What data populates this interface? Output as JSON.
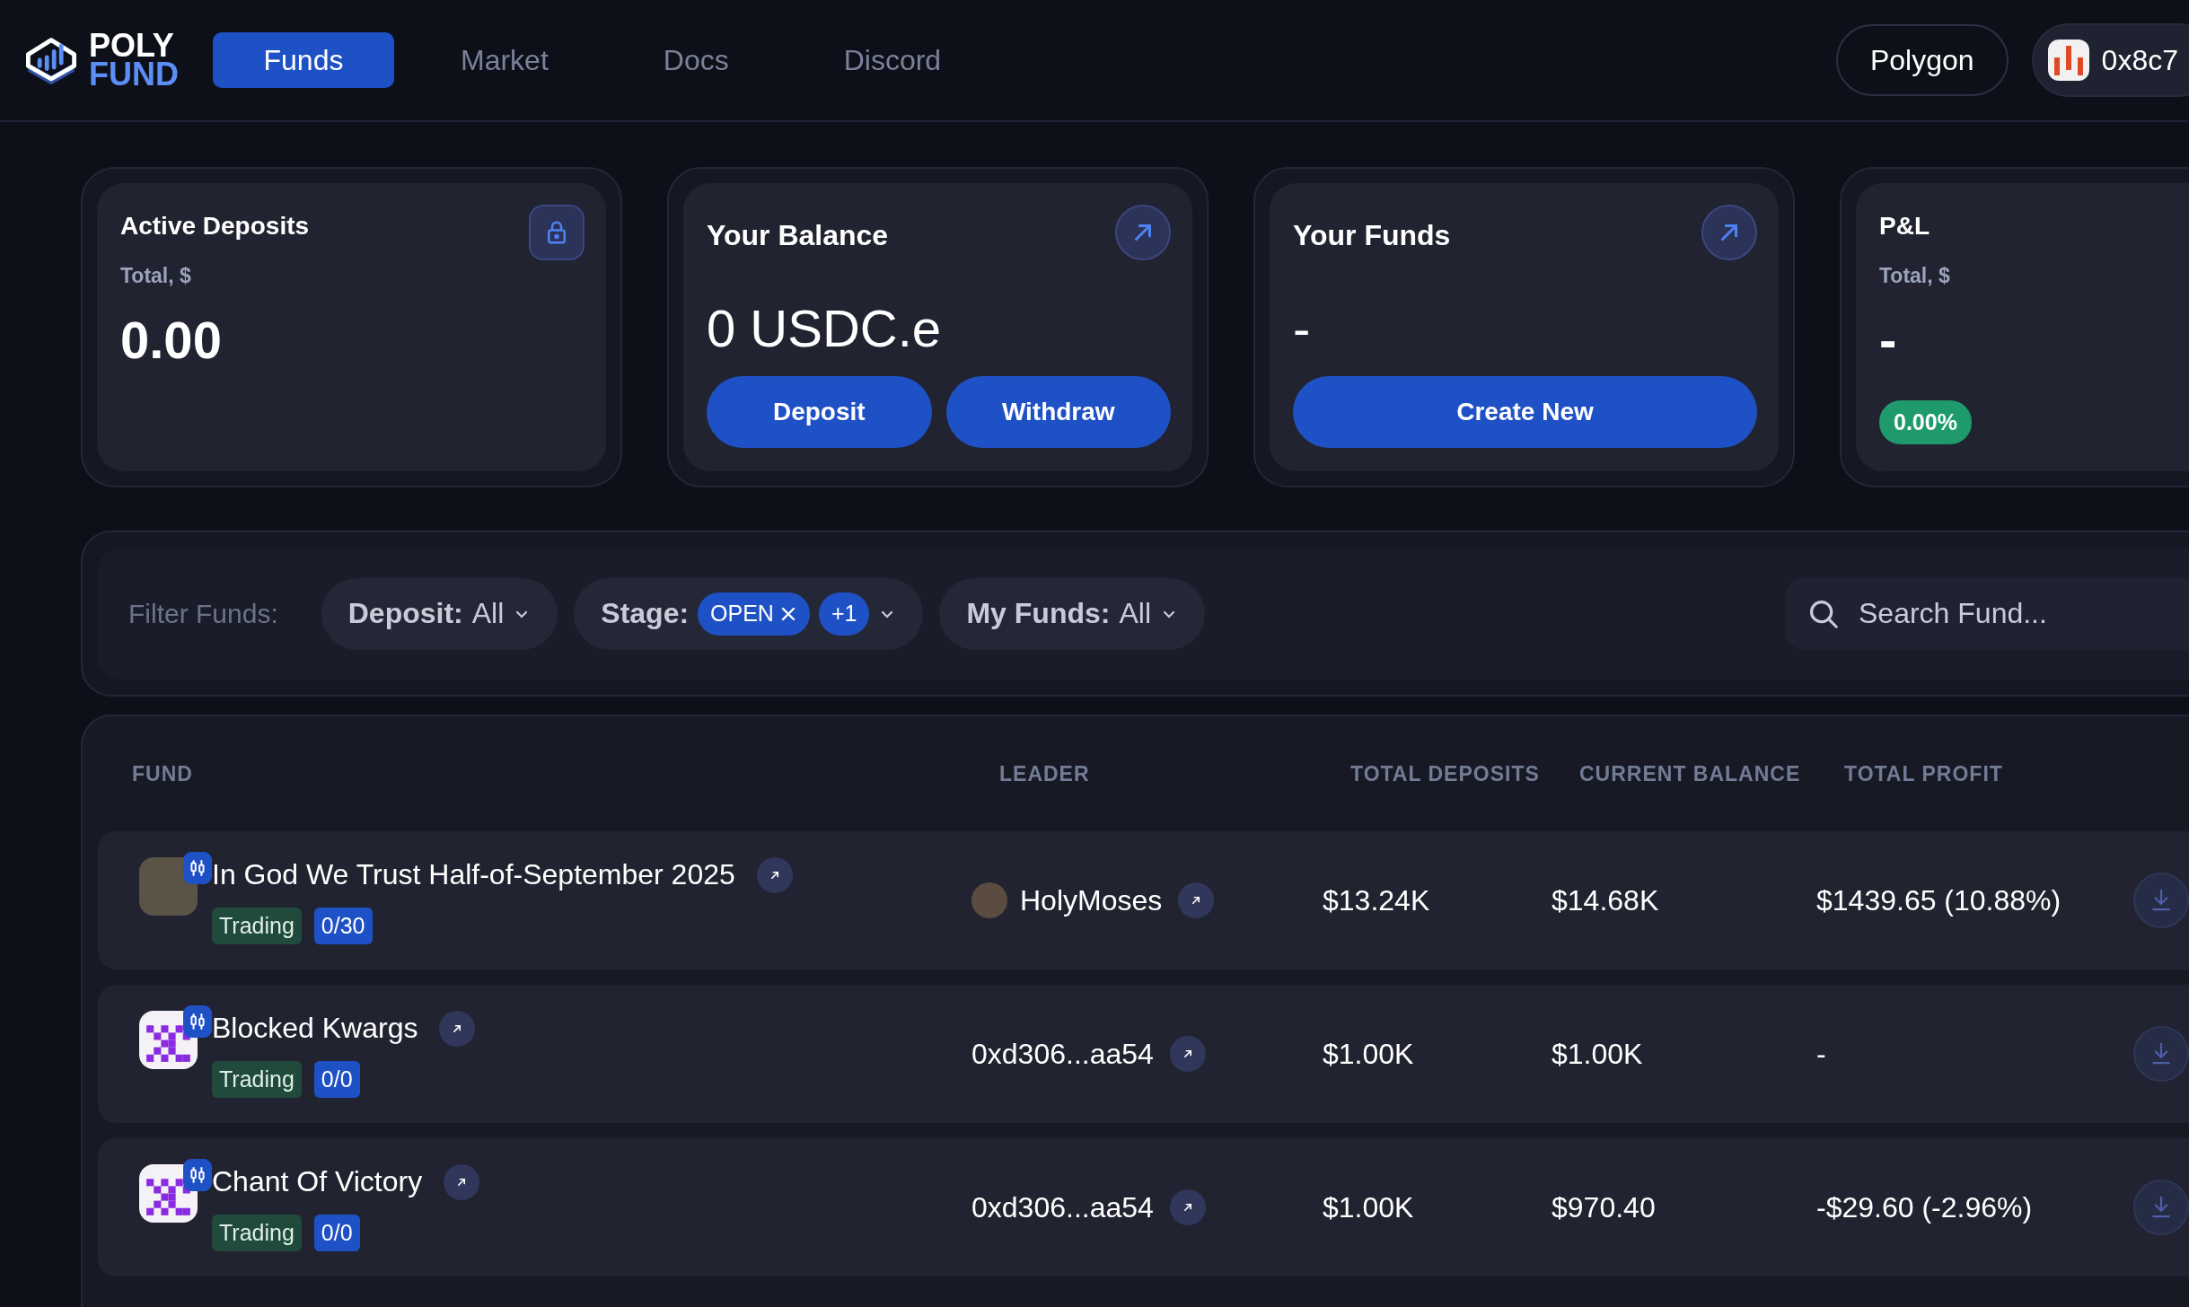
{
  "header": {
    "logo": {
      "line1": "POLY",
      "line2": "FUND"
    },
    "nav": [
      {
        "label": "Funds",
        "selected": true
      },
      {
        "label": "Market",
        "selected": false
      },
      {
        "label": "Docs",
        "selected": false
      },
      {
        "label": "Discord",
        "selected": false
      }
    ],
    "network": "Polygon",
    "wallet": "0x8c7"
  },
  "cards": [
    {
      "kind": "stat",
      "title": "Active Deposits",
      "subtitle": "Total, $",
      "value": "0.00",
      "corner_icon": {
        "kind": "lock"
      }
    },
    {
      "kind": "action",
      "title": "Your Balance",
      "value": "0 USDC.e",
      "corner_icon": {
        "kind": "arrow"
      },
      "buttons": [
        "Deposit",
        "Withdraw"
      ]
    },
    {
      "kind": "action",
      "title": "Your Funds",
      "value": "-",
      "corner_icon": {
        "kind": "arrow"
      },
      "buttons": [
        "Create New"
      ]
    },
    {
      "kind": "stat",
      "title": "P&L",
      "subtitle": "Total, $",
      "value": "-",
      "badge": "0.00%"
    }
  ],
  "filters": {
    "label": "Filter Funds:",
    "dropdowns": [
      {
        "kind": "simple",
        "label": "Deposit:",
        "value": "All"
      },
      {
        "kind": "chips",
        "label": "Stage:",
        "chips": [
          {
            "text": "OPEN",
            "removable": true
          },
          {
            "text": "+1",
            "removable": false
          }
        ]
      },
      {
        "kind": "simple",
        "label": "My Funds:",
        "value": "All"
      }
    ],
    "search": {
      "placeholder": "Search Fund..."
    }
  },
  "table": {
    "columns": [
      "FUND",
      "LEADER",
      "TOTAL DEPOSITS",
      "CURRENT BALANCE",
      "TOTAL PROFIT"
    ],
    "rows": [
      {
        "avatar": {
          "kind": "photo"
        },
        "fund": "In God We Trust Half-of-September 2025",
        "status": "Trading",
        "slots": "0/30",
        "leader": {
          "kind": "user",
          "name": "HolyMoses"
        },
        "total_deposits": "$13.24K",
        "current_balance": "$14.68K",
        "total_profit": "$1439.65 (10.88%)"
      },
      {
        "avatar": {
          "kind": "identicon"
        },
        "fund": "Blocked Kwargs",
        "status": "Trading",
        "slots": "0/0",
        "leader": {
          "kind": "address",
          "name": "0xd306...aa54"
        },
        "total_deposits": "$1.00K",
        "current_balance": "$1.00K",
        "total_profit": "-"
      },
      {
        "avatar": {
          "kind": "identicon"
        },
        "fund": "Chant Of Victory",
        "status": "Trading",
        "slots": "0/0",
        "leader": {
          "kind": "address",
          "name": "0xd306...aa54"
        },
        "total_deposits": "$1.00K",
        "current_balance": "$970.40",
        "total_profit": "-$29.60 (-2.96%)"
      }
    ]
  }
}
